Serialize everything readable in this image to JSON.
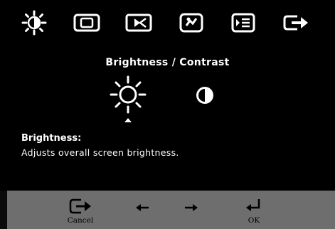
{
  "menu": {
    "items": [
      {
        "name": "brightness-contrast-icon"
      },
      {
        "name": "image-position-icon"
      },
      {
        "name": "image-setup-icon"
      },
      {
        "name": "image-properties-icon"
      },
      {
        "name": "options-icon"
      },
      {
        "name": "exit-icon"
      }
    ]
  },
  "submenu": {
    "title": "Brightness / Contrast",
    "selected": "brightness"
  },
  "description": {
    "heading": "Brightness:",
    "text": "Adjusts overall screen brightness."
  },
  "buttons": {
    "cancel_label": "Cancel",
    "ok_label": "OK"
  },
  "colors": {
    "osd_background": "#000000",
    "button_bar": "#6e6e6e",
    "icon": "#ffffff"
  }
}
